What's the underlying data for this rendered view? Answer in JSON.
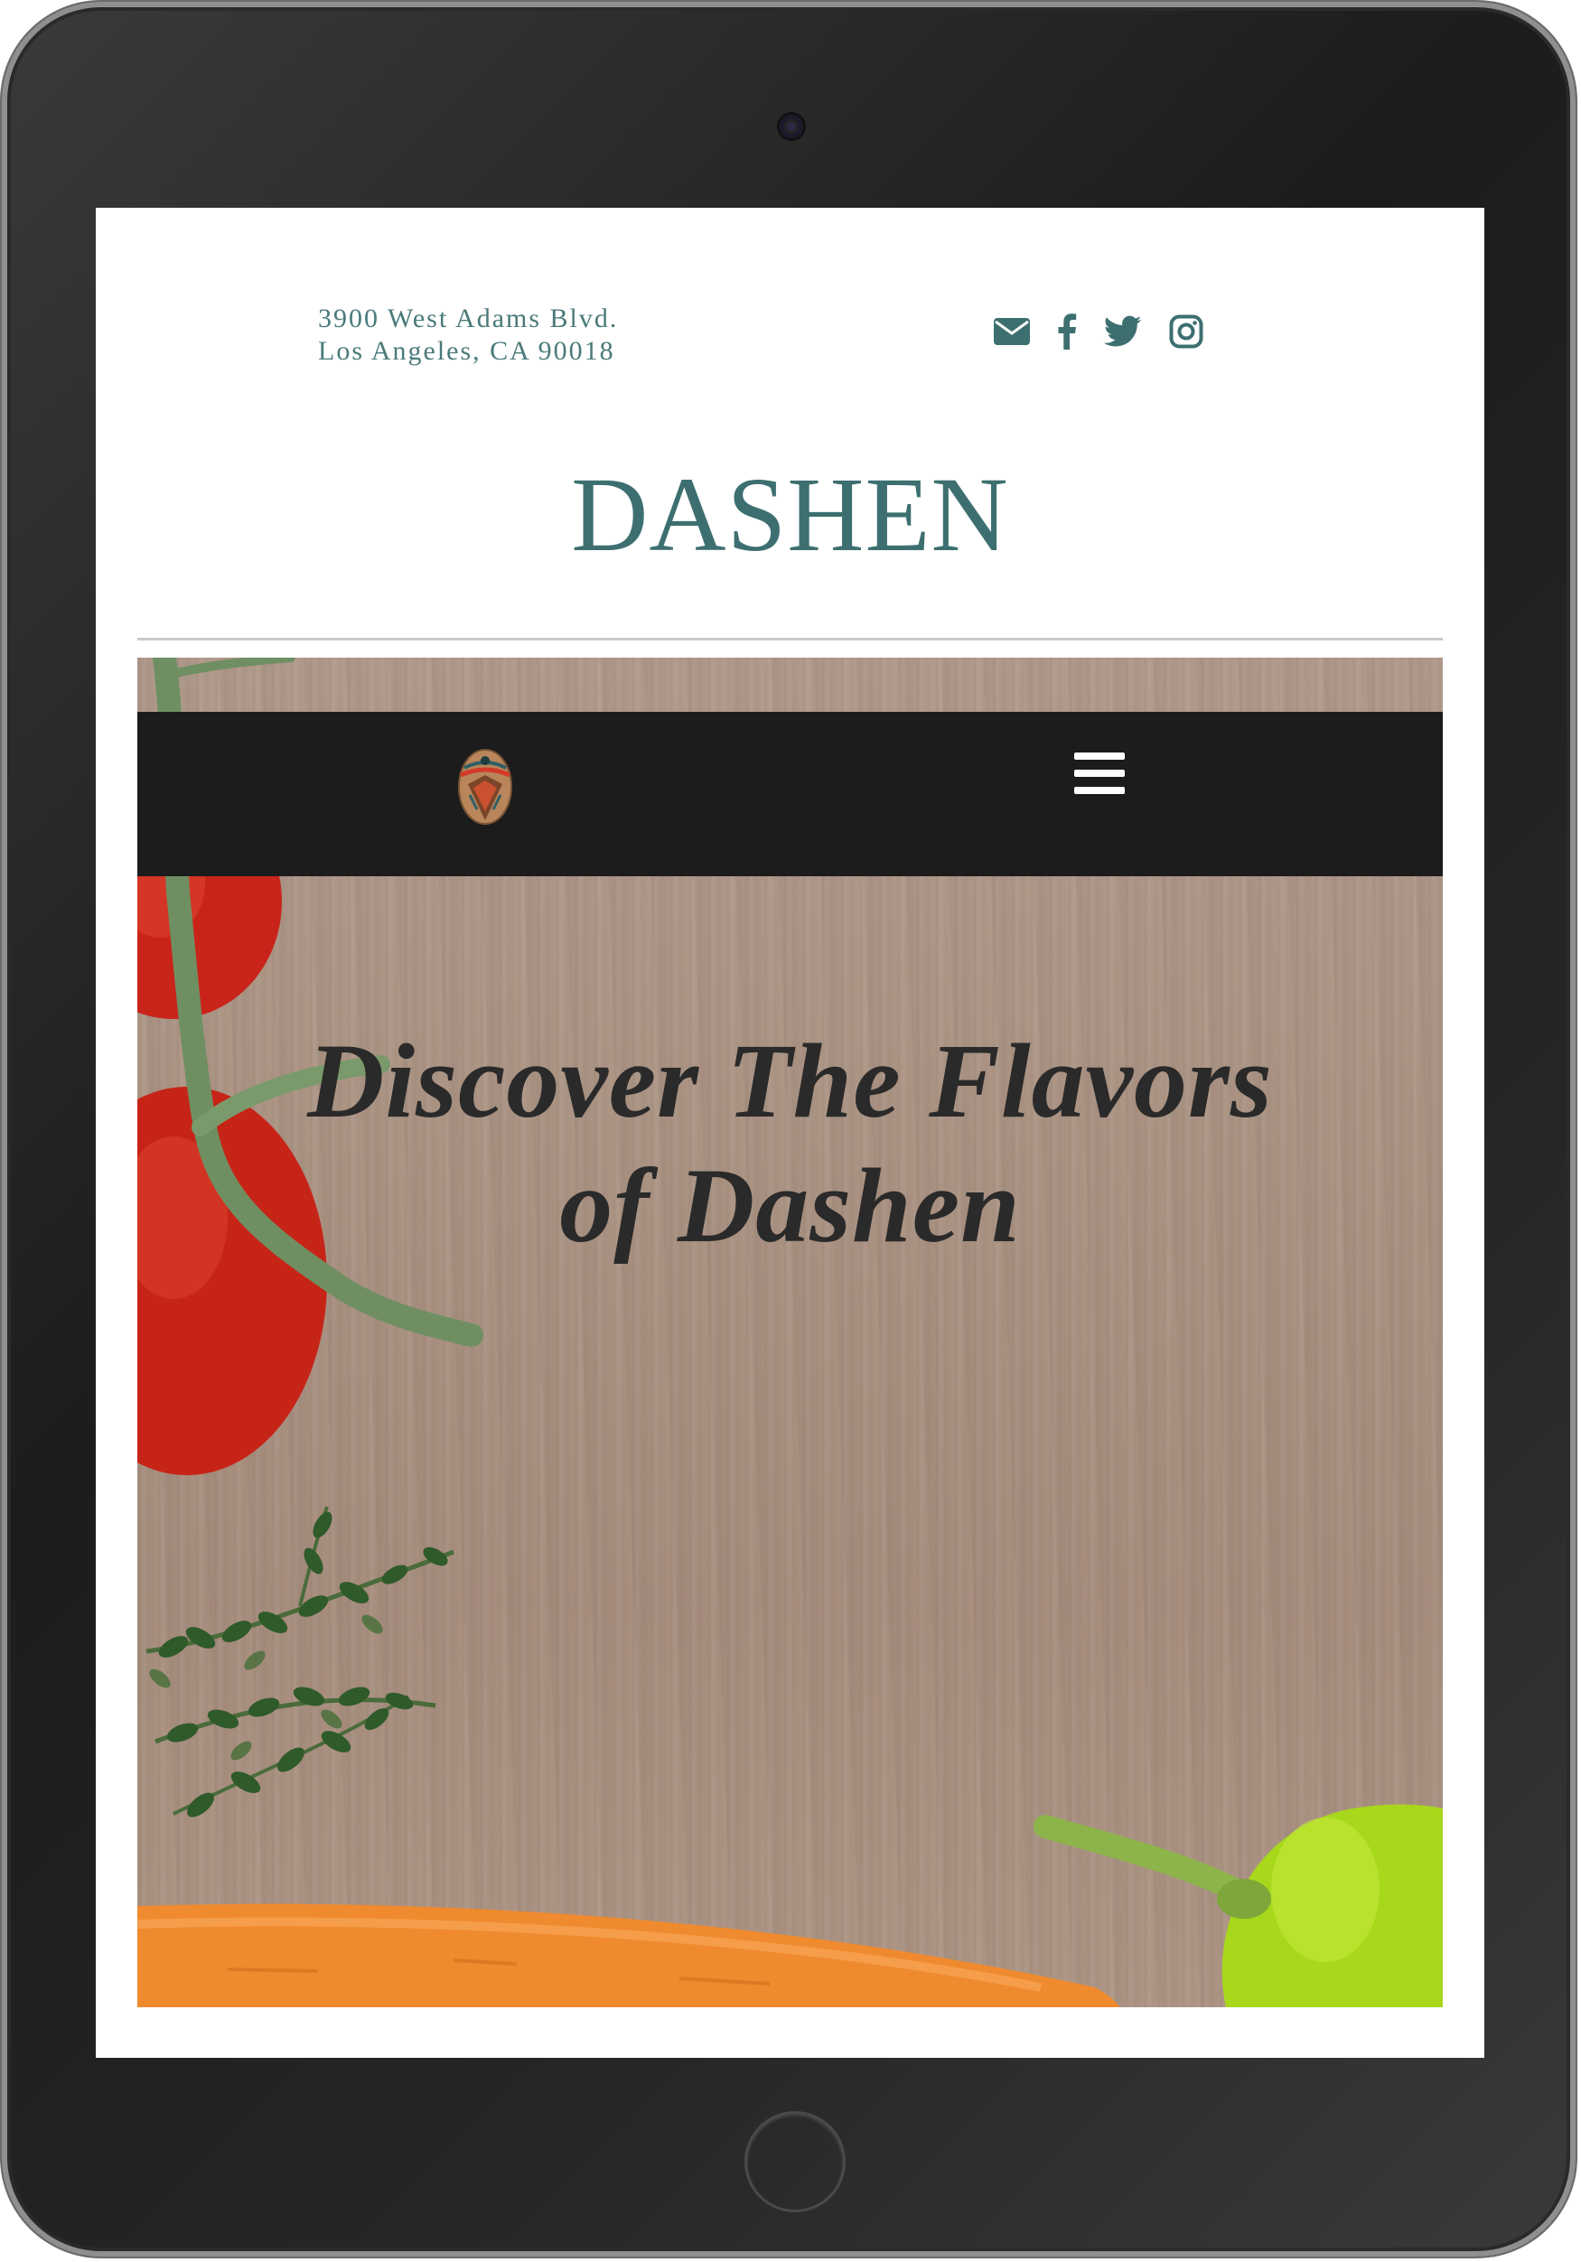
{
  "header": {
    "address_line1": "3900 West Adams Blvd.",
    "address_line2": "Los Angeles, CA 90018",
    "social_icons": [
      "envelope-icon",
      "facebook-icon",
      "twitter-icon",
      "instagram-icon"
    ],
    "brand_name": "DASHEN"
  },
  "hero": {
    "headline_line1": "Discover The Flavors",
    "headline_line2": "of Dashen"
  },
  "navbar": {
    "logo_icon": "dashen-logo-icon",
    "menu_icon": "hamburger-menu-icon"
  },
  "colors": {
    "brand_teal": "#3d6f70",
    "address_teal": "#4a7a7a",
    "navbar_bg": "#1c1c1c",
    "headline": "#2a2a2a"
  }
}
